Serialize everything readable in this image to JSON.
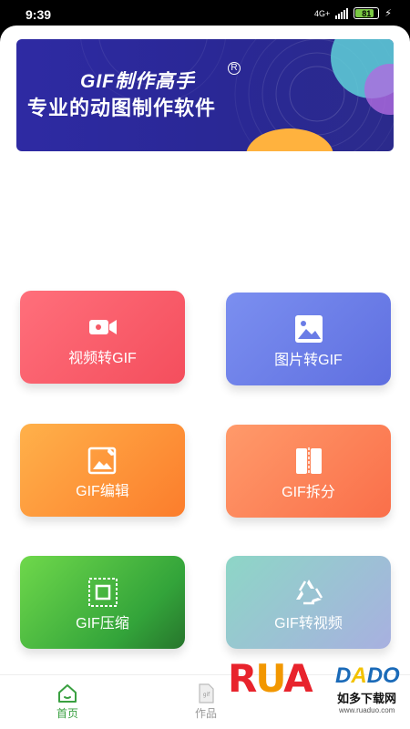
{
  "status_bar": {
    "time": "9:39",
    "network": "4G+",
    "battery": "81",
    "battery_level_pct": 81
  },
  "banner": {
    "title": "GIF制作高手",
    "registered_mark": "R",
    "subtitle": "专业的动图制作软件"
  },
  "cards": [
    {
      "label": "视频转GIF",
      "icon": "video-camera-icon"
    },
    {
      "label": "图片转GIF",
      "icon": "image-icon"
    },
    {
      "label": "GIF编辑",
      "icon": "edit-image-icon"
    },
    {
      "label": "GIF拆分",
      "icon": "split-icon"
    },
    {
      "label": "GIF压缩",
      "icon": "compress-icon"
    },
    {
      "label": "GIF转视频",
      "icon": "recycle-icon"
    }
  ],
  "bottom_nav": [
    {
      "label": "首页",
      "icon": "home-icon",
      "active": true
    },
    {
      "label": "作品",
      "icon": "gif-file-icon",
      "active": false
    }
  ],
  "watermark": {
    "logo": "RUANDADO",
    "text_zh": "如多下载网",
    "url": "www.ruaduo.com"
  },
  "colors": {
    "brand_green": "#3aa041",
    "banner_blue": "#2e2aa3"
  }
}
